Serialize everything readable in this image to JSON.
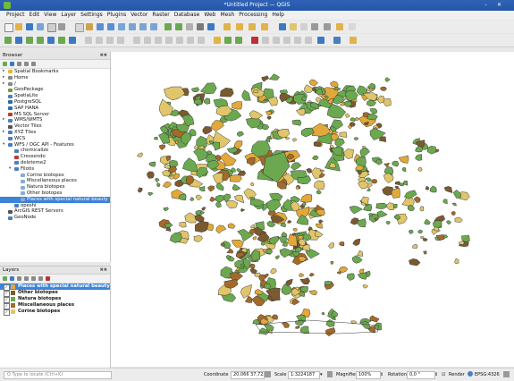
{
  "window": {
    "title": "*Untitled Project — QGIS"
  },
  "menubar": [
    "Project",
    "Edit",
    "View",
    "Layer",
    "Settings",
    "Plugins",
    "Vector",
    "Raster",
    "Database",
    "Web",
    "Mesh",
    "Processing",
    "Help"
  ],
  "browser": {
    "title": "Browser",
    "items": [
      {
        "label": "Spatial Bookmarks",
        "level": 0,
        "expand": "▸",
        "color": "#e3b53d"
      },
      {
        "label": "Home",
        "level": 0,
        "expand": "▸",
        "color": "#888888"
      },
      {
        "label": "/",
        "level": 0,
        "expand": "▸",
        "color": "#888888"
      },
      {
        "label": "GeoPackage",
        "level": 0,
        "expand": "",
        "color": "#6a9f3a"
      },
      {
        "label": "SpatiaLite",
        "level": 0,
        "expand": "",
        "color": "#4a7fc0"
      },
      {
        "label": "PostgreSQL",
        "level": 0,
        "expand": "",
        "color": "#336791"
      },
      {
        "label": "SAP HANA",
        "level": 0,
        "expand": "",
        "color": "#1e73be"
      },
      {
        "label": "MS SQL Server",
        "level": 0,
        "expand": "",
        "color": "#c0392b"
      },
      {
        "label": "WMS/WMTS",
        "level": 0,
        "expand": "▸",
        "color": "#4a7fc0"
      },
      {
        "label": "Vector Tiles",
        "level": 0,
        "expand": "",
        "color": "#555555"
      },
      {
        "label": "XYZ Tiles",
        "level": 0,
        "expand": "▸",
        "color": "#4a7fc0"
      },
      {
        "label": "WCS",
        "level": 0,
        "expand": "",
        "color": "#4a7fc0"
      },
      {
        "label": "WFS / OGC API - Features",
        "level": 0,
        "expand": "▾",
        "color": "#4a7fc0"
      },
      {
        "label": "chemicalize",
        "level": 1,
        "expand": "",
        "color": "#4a7fc0"
      },
      {
        "label": "Cressendo",
        "level": 1,
        "expand": "",
        "color": "#c0392b"
      },
      {
        "label": "deleteme2",
        "level": 1,
        "expand": "",
        "color": "#4a7fc0"
      },
      {
        "label": "Filotis",
        "level": 1,
        "expand": "▾",
        "color": "#4a7fc0"
      },
      {
        "label": "Corine biotopes",
        "level": 2,
        "expand": "",
        "color": "#8aa9d6"
      },
      {
        "label": "Miscellaneous places",
        "level": 2,
        "expand": "",
        "color": "#8aa9d6"
      },
      {
        "label": "Natura biotopes",
        "level": 2,
        "expand": "",
        "color": "#8aa9d6"
      },
      {
        "label": "Other biotopes",
        "level": 2,
        "expand": "",
        "color": "#8aa9d6"
      },
      {
        "label": "Places with special natural beauty",
        "level": 2,
        "expand": "",
        "color": "#8aa9d6",
        "selected": true
      },
      {
        "label": "opeshi",
        "level": 1,
        "expand": "",
        "color": "#4a7fc0"
      },
      {
        "label": "ArcGIS REST Servers",
        "level": 0,
        "expand": "",
        "color": "#555555"
      },
      {
        "label": "GeoNode",
        "level": 0,
        "expand": "",
        "color": "#4a7fc0"
      }
    ]
  },
  "layers": {
    "title": "Layers",
    "items": [
      {
        "label": "Places with special natural beauty",
        "color": "#e3a83a",
        "checked": "✓",
        "selected": true
      },
      {
        "label": "Other biotopes",
        "color": "#7b5a30",
        "checked": "✓"
      },
      {
        "label": "Natura biotopes",
        "color": "#6ba84f",
        "checked": "✓"
      },
      {
        "label": "Miscellaneous places",
        "color": "#a36a2a",
        "checked": "✓"
      },
      {
        "label": "Corine biotopes",
        "color": "#e0c56a",
        "checked": "✓"
      }
    ]
  },
  "statusbar": {
    "locate_placeholder": "Q  Type to locate (Ctrl+K)",
    "coordinate_label": "Coordinate",
    "coordinate_value": "20,066 37,722",
    "scale_label": "Scale",
    "scale_value": "1:3224187",
    "magnifier_label": "Magnifier",
    "magnifier_value": "100%",
    "rotation_label": "Rotation",
    "rotation_value": "0,0 °",
    "render_label": "Render",
    "crs_label": "EPSG:4326"
  },
  "colors": {
    "natura": "#6ba84f",
    "corine": "#e0c56a",
    "misc": "#a36a2a",
    "other": "#7b5a30",
    "beauty": "#e3a83a",
    "selection": "#3d83d8"
  }
}
